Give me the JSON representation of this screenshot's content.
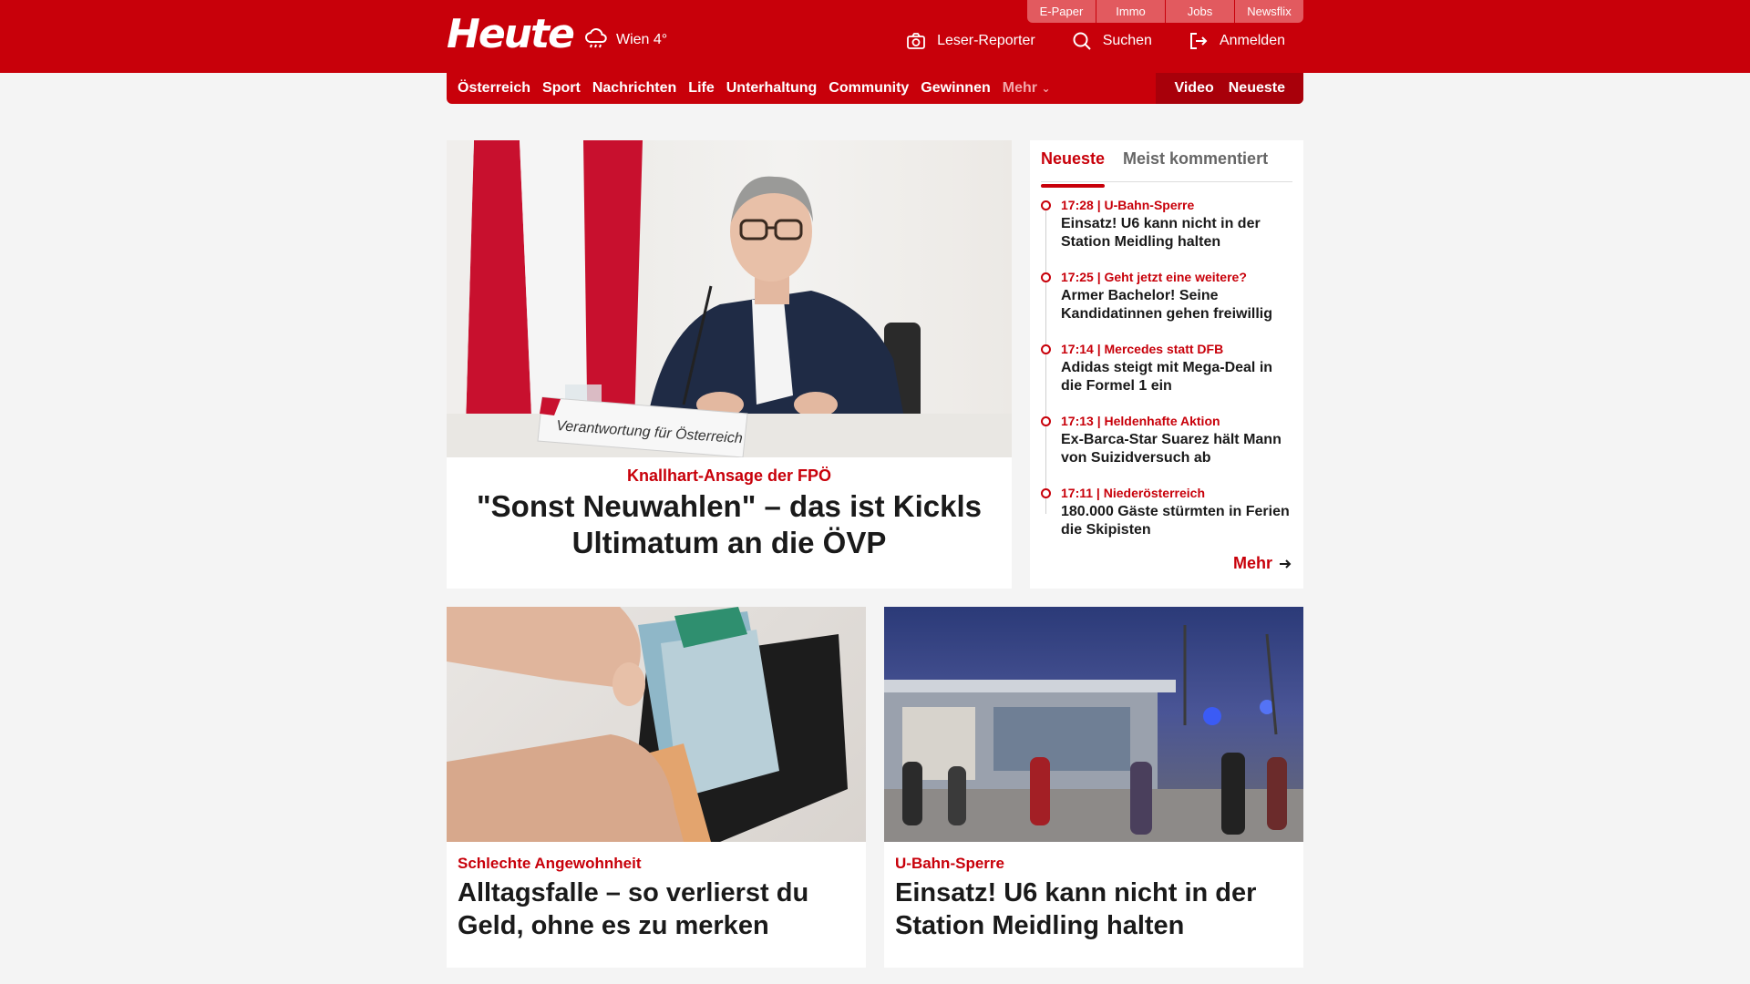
{
  "header": {
    "logo": "Heute",
    "weather": "Wien 4°",
    "util_links": [
      "E-Paper",
      "Immo",
      "Jobs",
      "Newsflix"
    ],
    "actions": {
      "reporter": "Leser-Reporter",
      "search": "Suchen",
      "login": "Anmelden"
    }
  },
  "nav": {
    "items": [
      "Österreich",
      "Sport",
      "Nachrichten",
      "Life",
      "Unterhaltung",
      "Community",
      "Gewinnen"
    ],
    "more": "Mehr",
    "right": [
      "Video",
      "Neueste"
    ]
  },
  "lead": {
    "kicker": "Knallhart-Ansage der FPÖ",
    "headline": "\"Sonst Neuwahlen\" – das ist Kickls Ultimatum an die ÖVP",
    "image_sign": "Verantwortung für Österreich"
  },
  "sidebar": {
    "tabs": [
      "Neueste",
      "Meist kommentiert"
    ],
    "items": [
      {
        "meta": "17:28 | U-Bahn-Sperre",
        "title": "Einsatz! U6 kann nicht in der Station Meidling halten"
      },
      {
        "meta": "17:25 | Geht jetzt eine weitere?",
        "title": "Armer Bachelor! Seine Kandidatinnen gehen freiwillig"
      },
      {
        "meta": "17:14 | Mercedes statt DFB",
        "title": "Adidas steigt mit Mega-Deal in die Formel 1 ein"
      },
      {
        "meta": "17:13 | Heldenhafte Aktion",
        "title": "Ex-Barca-Star Suarez hält Mann von Suizidversuch ab"
      },
      {
        "meta": "17:11 | Niederösterreich",
        "title": "180.000 Gäste stürmten in Ferien die Skipisten"
      }
    ],
    "more": "Mehr"
  },
  "teasers": [
    {
      "kicker": "Schlechte Angewohnheit",
      "headline": "Alltagsfalle – so verlierst du Geld, ohne es zu merken"
    },
    {
      "kicker": "U-Bahn-Sperre",
      "headline": "Einsatz! U6 kann nicht in der Station Meidling halten"
    }
  ],
  "colors": {
    "brand": "#c8000a",
    "utility": "#e25a5f",
    "background": "#f4f4f4"
  }
}
